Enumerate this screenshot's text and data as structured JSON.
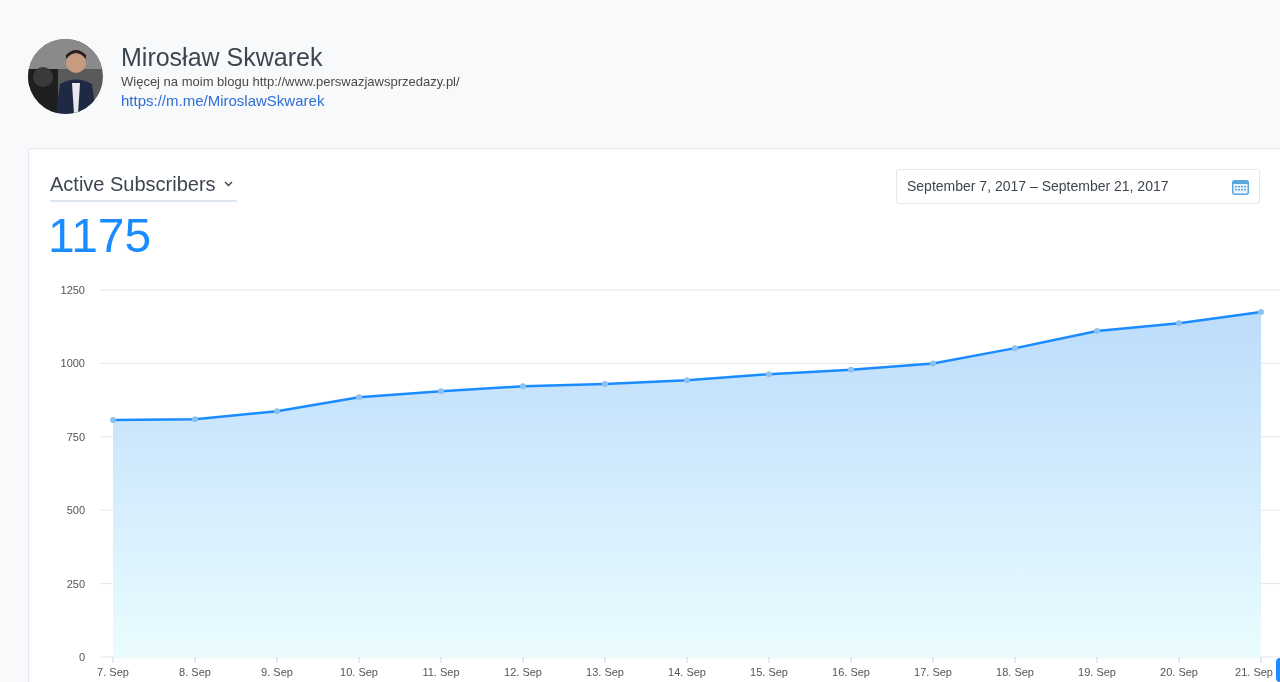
{
  "profile": {
    "name": "Mirosław Skwarek",
    "description": "Więcej na moim blogu http://www.perswazjawsprzedazy.pl/",
    "link": "https://m.me/MiroslawSkwarek"
  },
  "metric": {
    "label": "Active Subscribers",
    "value": "1175"
  },
  "date_range": {
    "value": "September 7, 2017 – September 21, 2017"
  },
  "chart_data": {
    "type": "area",
    "categories": [
      "7. Sep",
      "8. Sep",
      "9. Sep",
      "10. Sep",
      "11. Sep",
      "12. Sep",
      "13. Sep",
      "14. Sep",
      "15. Sep",
      "16. Sep",
      "17. Sep",
      "18. Sep",
      "19. Sep",
      "20. Sep",
      "21. Sep"
    ],
    "series": [
      {
        "color": "#1a8cff",
        "values": [
          807,
          810,
          837,
          885,
          905,
          922,
          930,
          943,
          963,
          978,
          1000,
          1052,
          1110,
          1137,
          1175
        ]
      }
    ],
    "grid": true,
    "ylim": [
      0,
      1250
    ],
    "yticks": [
      0,
      250,
      500,
      750,
      1000,
      1250
    ]
  }
}
